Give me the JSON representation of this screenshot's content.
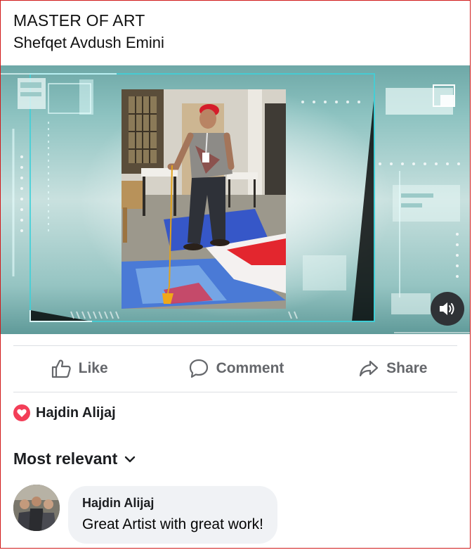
{
  "post": {
    "title": "MASTER OF ART",
    "author": "Shefqet Avdush Emini"
  },
  "video": {
    "sound_icon": "speaker-icon"
  },
  "actions": {
    "like": "Like",
    "comment": "Comment",
    "share": "Share"
  },
  "reactions": {
    "icon": "heart-icon",
    "name": "Hajdin Alijaj"
  },
  "comments_sort": {
    "label": "Most relevant"
  },
  "comments": [
    {
      "author": "Hajdin Alijaj",
      "text": "Great Artist with great work!"
    }
  ],
  "colors": {
    "heart": "#f33e58",
    "action_text": "#65676b",
    "bubble": "#f0f2f5",
    "frame_border": "#d11a1a"
  }
}
